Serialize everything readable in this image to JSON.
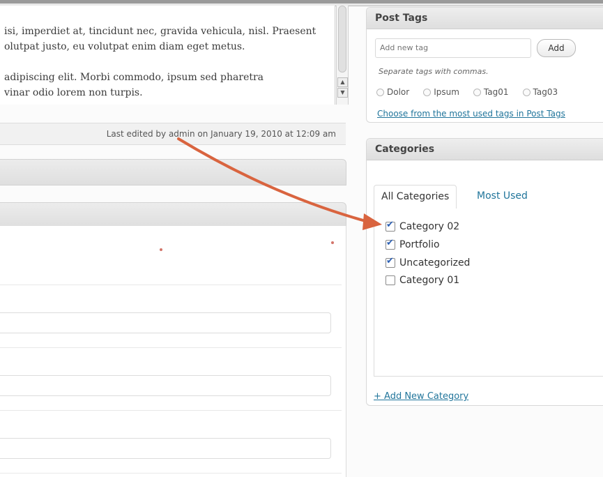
{
  "editor": {
    "para1_line1": "isi, imperdiet at, tincidunt nec, gravida vehicula, nisl. Praesent",
    "para1_line2": "olutpat justo, eu volutpat enim diam eget metus.",
    "para2_line1": "adipiscing elit. Morbi commodo, ipsum sed pharetra",
    "para2_line2": "vinar odio lorem non turpis."
  },
  "status": {
    "last_edited": "Last edited by admin on January 19, 2010 at 12:09 am"
  },
  "tags_box": {
    "title": "Post Tags",
    "input_placeholder": "Add new tag",
    "add_label": "Add",
    "hint": "Separate tags with commas.",
    "tags": [
      "Dolor",
      "Ipsum",
      "Tag01",
      "Tag03"
    ],
    "most_used_link": "Choose from the most used tags in Post Tags"
  },
  "categories_box": {
    "title": "Categories",
    "tab_all": "All Categories",
    "tab_most_used": "Most Used",
    "items": [
      {
        "label": "Category 02",
        "checked": true
      },
      {
        "label": "Portfolio",
        "checked": true
      },
      {
        "label": "Uncategorized",
        "checked": true
      },
      {
        "label": "Category 01",
        "checked": false
      }
    ],
    "add_link": "+ Add New Category"
  },
  "colors": {
    "link": "#21759b",
    "arrow": "#d9643f",
    "required_dot": "#c0392b"
  }
}
